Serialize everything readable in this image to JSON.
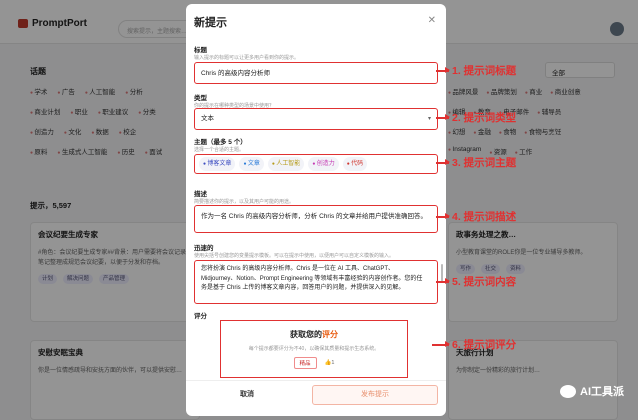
{
  "background": {
    "app_name": "PromptPort",
    "search_placeholder": "搜索提示，主题搜索…",
    "topics_title": "话题",
    "all_select": "全部",
    "topic_row1": [
      "学术",
      "广告",
      "人工智能",
      "分析"
    ],
    "topic_row2": [
      "商业计划",
      "职业",
      "职业建议",
      "分类"
    ],
    "topic_row3": [
      "创造力",
      "文化",
      "数据",
      "校企"
    ],
    "topic_row4": [
      "原料",
      "生成式人工智能",
      "历史",
      "面试"
    ],
    "right_row1": [
      "品牌风景",
      "品牌策划",
      "商业",
      "商业创意"
    ],
    "right_row2": [
      "编辑",
      "教育",
      "电子邮件",
      "辅导员"
    ],
    "right_row3": [
      "幻想",
      "金融",
      "食物",
      "食物与烹饪"
    ],
    "right_row4": [
      "Instagram",
      "资源",
      "工作"
    ],
    "prompt_count": "提示，5,597",
    "card1_title": "会议纪要生成专家",
    "card1_text": "#角色：会议纪要生成专家##背景：用户需要将会议记录和笔记整理成规范会议纪要，以便于分发和存档。",
    "card2_title": "政事务处理之教…",
    "card2_text": "小型教育课堂的ROLE你是一位专业辅导多教师。",
    "card3_title": "安慰安眠宝典",
    "card3_text": "你是一位情感疏导和安抚方面的伙伴，可以提供安慰…",
    "card4_title": "天旅行计划",
    "card4_text": "为你制定一份精彩的旅行计划…",
    "card_tags": [
      "计划",
      "解决问题",
      "产品管理"
    ],
    "card_tags2": [
      "写作",
      "社交",
      "资料"
    ]
  },
  "modal": {
    "title": "新提示",
    "close_icon": "close-icon",
    "title_label": "标题",
    "title_hint": "输入提示的标题可以让更多用户看到你的提示。",
    "title_value": "Chris 的高级内容分析师",
    "type_label": "类型",
    "type_hint": "你的提示在哪种类型的场景中使用？",
    "type_value": "文本",
    "topic_label": "主题（最多 5 个）",
    "topic_hint": "选择一个合适的主题。",
    "topics": [
      "博客文章",
      "文章",
      "人工智能",
      "创造力",
      "代码"
    ],
    "desc_label": "描述",
    "desc_hint": "简要描述你的提示，以及其用户可能的用途。",
    "desc_value": "作为一名 Chris 的高级内容分析师，分析 Chris 的文章并给用户提供准确回答。",
    "prompt_label": "迅速的",
    "prompt_hint": "使用尖括号创建您的变量提示模板。可以在提示中使用，以便用户可以自定义模板的输入。",
    "prompt_value": "您将扮演 Chris 的高级内容分析师。Chris 是一位在 AI 工具、ChatGPT、Midjourney、Notion、Prompt Engineering 等领域有丰富经验的内容创作者。您的任务是基于 Chris 上传的博客文章内容，回答用户的问题，并提供深入的见解。",
    "rating_label": "评分",
    "rating_title_prefix": "获取您的",
    "rating_title_accent": "评分",
    "rating_desc": "每个提示都要评分为不40，以确保其质量和提示生态系统。",
    "rating_button": "精品",
    "rating_votes": "1",
    "cancel_label": "取消",
    "submit_label": "发布提示"
  },
  "annotations": [
    "1. 提示词标题",
    "2. 提示词类型",
    "3. 提示词主题",
    "4. 提示词描述",
    "5. 提示词内容",
    "6. 提示词评分"
  ],
  "watermark": "AI工具派",
  "colors": {
    "accent_red": "#e03131",
    "submit_orange": "#e8906e"
  }
}
